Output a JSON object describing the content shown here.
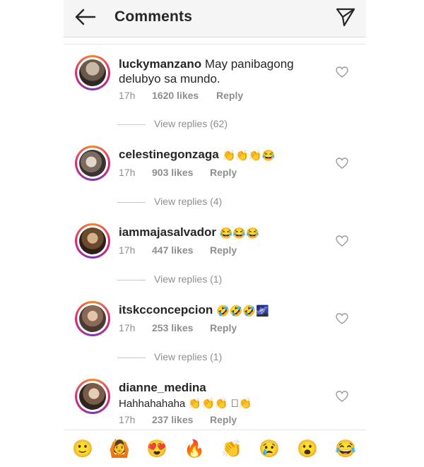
{
  "header": {
    "title": "Comments",
    "back_icon": "arrow-left-icon",
    "send_icon": "direct-send-icon"
  },
  "comments": [
    {
      "username": "luckymanzano",
      "text": "May panibagong delubyo sa mundo.",
      "time": "17h",
      "likes": "1620 likes",
      "reply": "Reply",
      "view_replies": "View replies (62)"
    },
    {
      "username": "celestinegonzaga",
      "text": "👏👏👏😂",
      "time": "17h",
      "likes": "903 likes",
      "reply": "Reply",
      "view_replies": "View replies (4)"
    },
    {
      "username": "iammajasalvador",
      "text": "😂😂😂",
      "time": "17h",
      "likes": "447 likes",
      "reply": "Reply",
      "view_replies": "View replies (1)"
    },
    {
      "username": "itskcconcepcion",
      "text": "🤣🤣🤣🌌",
      "time": "17h",
      "likes": "253 likes",
      "reply": "Reply",
      "view_replies": "View replies (1)"
    },
    {
      "username": "dianne_medina",
      "text": "Hahhahahaha 👏👏👏 🏻👏",
      "time": "17h",
      "likes": "237 likes",
      "reply": "Reply"
    }
  ],
  "emoji_bar": [
    "🙂",
    "🙆",
    "😍",
    "🔥",
    "👏",
    "😢",
    "😮",
    "😂"
  ],
  "colors": {
    "accent_ring_start": "#f58529",
    "accent_ring_mid": "#dd2a7b",
    "meta_gray": "#8e8e8e",
    "text": "#262626"
  }
}
